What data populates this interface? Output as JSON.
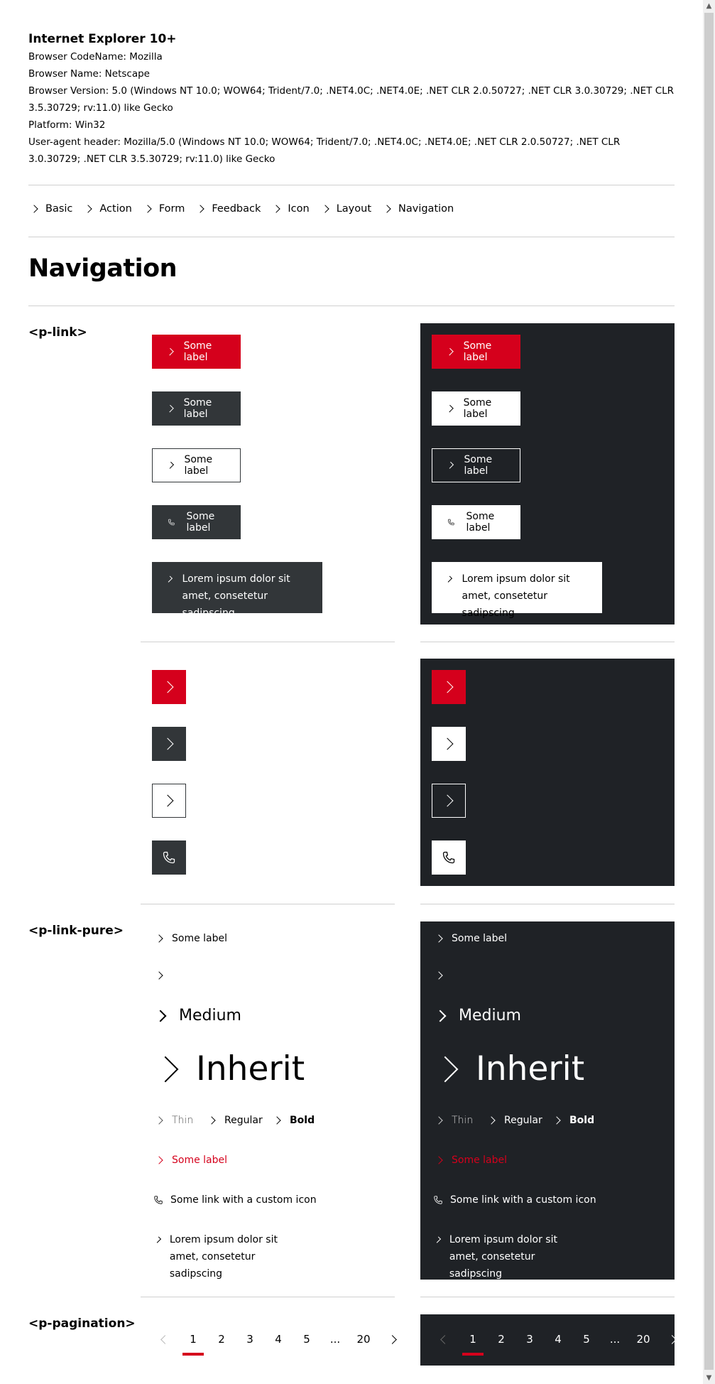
{
  "browser_info": {
    "title": "Internet Explorer 10+",
    "lines": [
      "Browser CodeName: Mozilla",
      "Browser Name: Netscape",
      "Browser Version: 5.0 (Windows NT 10.0; WOW64; Trident/7.0; .NET4.0C; .NET4.0E; .NET CLR 2.0.50727; .NET CLR 3.0.30729; .NET CLR 3.5.30729; rv:11.0) like Gecko",
      "Platform: Win32",
      "User-agent header: Mozilla/5.0 (Windows NT 10.0; WOW64; Trident/7.0; .NET4.0C; .NET4.0E; .NET CLR 2.0.50727; .NET CLR 3.0.30729; .NET CLR 3.5.30729; rv:11.0) like Gecko"
    ]
  },
  "nav": {
    "items": [
      "Basic",
      "Action",
      "Form",
      "Feedback",
      "Icon",
      "Layout",
      "Navigation"
    ]
  },
  "page_title": "Navigation",
  "sections": {
    "link": "<p-link>",
    "link_pure": "<p-link-pure>",
    "pagination": "<p-pagination>"
  },
  "link": {
    "label": "Some label",
    "long_label": "Lorem ipsum dolor sit amet, consetetur sadipscing"
  },
  "link_pure": {
    "label": "Some label",
    "medium": "Medium",
    "inherit": "Inherit",
    "thin": "Thin",
    "regular": "Regular",
    "bold": "Bold",
    "active_label": "Some label",
    "custom_icon": "Some link with a custom icon",
    "long_label": "Lorem ipsum dolor sit amet, consetetur sadipscing"
  },
  "pagination": {
    "pages": [
      "1",
      "2",
      "3",
      "4",
      "5",
      "...",
      "20"
    ],
    "active": "1"
  },
  "colors": {
    "brand_red": "#d5001c",
    "dark_bg": "#1f2226",
    "button_dark": "#323639"
  }
}
